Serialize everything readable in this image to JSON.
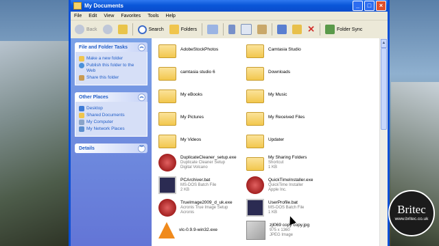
{
  "window": {
    "title": "My Documents",
    "controls": {
      "minimize": "_",
      "maximize": "□",
      "close": "×"
    }
  },
  "menu": [
    "File",
    "Edit",
    "View",
    "Favorites",
    "Tools",
    "Help"
  ],
  "toolbar": {
    "back": "Back",
    "search": "Search",
    "folders": "Folders",
    "folder_sync": "Folder Sync"
  },
  "taskpane": {
    "file_tasks": {
      "title": "File and Folder Tasks",
      "items": [
        "Make a new folder",
        "Publish this folder to the Web",
        "Share this folder"
      ]
    },
    "other_places": {
      "title": "Other Places",
      "items": [
        "Desktop",
        "Shared Documents",
        "My Computer",
        "My Network Places"
      ]
    },
    "details": {
      "title": "Details"
    }
  },
  "files": [
    {
      "name": "AdobeStockPhotos",
      "type": "folder"
    },
    {
      "name": "Camtasia Studio",
      "type": "folder"
    },
    {
      "name": "camtasia studio 6",
      "type": "folder"
    },
    {
      "name": "Downloads",
      "type": "folder"
    },
    {
      "name": "My eBooks",
      "type": "folder"
    },
    {
      "name": "My Music",
      "type": "music-folder"
    },
    {
      "name": "My Pictures",
      "type": "pictures-folder"
    },
    {
      "name": "My Received Files",
      "type": "folder"
    },
    {
      "name": "My Videos",
      "type": "videos-folder"
    },
    {
      "name": "Updater",
      "type": "folder"
    },
    {
      "name": "DuplicateCleaner_setup.exe",
      "sub1": "Duplicate Cleaner Setup",
      "sub2": "Digital Volcano",
      "type": "exe"
    },
    {
      "name": "My Sharing Folders",
      "sub1": "Shortcut",
      "sub2": "1 KB",
      "type": "shortcut"
    },
    {
      "name": "PCArchiver.bat",
      "sub1": "MS-DOS Batch File",
      "sub2": "2 KB",
      "type": "bat"
    },
    {
      "name": "QuickTimeInstaller.exe",
      "sub1": "QuickTime Installer",
      "sub2": "Apple Inc.",
      "type": "exe"
    },
    {
      "name": "TrueImage2009_d_uk.exe",
      "sub1": "Acronis True Image Setup",
      "sub2": "Acronis",
      "type": "exe"
    },
    {
      "name": "UserProfile.bat",
      "sub1": "MS-DOS Batch File",
      "sub2": "1 KB",
      "type": "bat"
    },
    {
      "name": "vlc-0.9.9-win32.exe",
      "sub1": "",
      "sub2": "",
      "type": "vlc"
    },
    {
      "name": "zjl069 copy copy.jpg",
      "sub1": "975 x 1360",
      "sub2": "JPEG Image",
      "type": "jpg"
    }
  ],
  "watermark": {
    "name": "Britec",
    "url": "www.britec.co.uk"
  }
}
